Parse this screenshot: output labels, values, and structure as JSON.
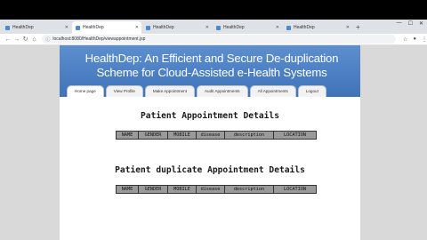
{
  "browser": {
    "tabs": [
      {
        "label": "HealthDep"
      },
      {
        "label": "HealthDep"
      },
      {
        "label": "HealthDep"
      },
      {
        "label": "HealthDep"
      },
      {
        "label": "HealthDep"
      }
    ],
    "new_tab": "+",
    "url": "localhost:8080/HealthDep/viewappointment.jsp",
    "window_controls": [
      "—",
      "☐",
      "✕"
    ]
  },
  "header": {
    "title": "HealthDep: An Efficient and Secure De-duplication Scheme for Cloud-Assisted e-Health Systems"
  },
  "nav": {
    "items": [
      {
        "label": "Home page"
      },
      {
        "label": "View Profile"
      },
      {
        "label": "Make Appointment"
      },
      {
        "label": "Audit Appointments"
      },
      {
        "label": "All Appointments"
      },
      {
        "label": "Logout"
      }
    ]
  },
  "main": {
    "section1_title": "Patient Appointment Details",
    "section2_title": "Patient duplicate Appointment Details",
    "columns": [
      "NAME",
      "GENDER",
      "MOBILE",
      "disease",
      "description",
      "LOCATION"
    ]
  }
}
